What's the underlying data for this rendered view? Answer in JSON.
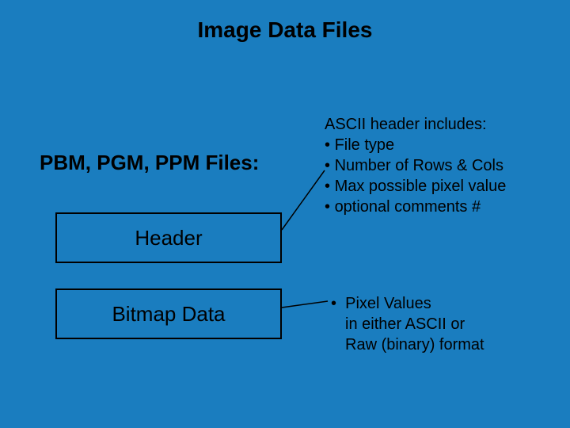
{
  "title": "Image Data Files",
  "subtitle": "PBM, PGM, PPM Files:",
  "boxes": {
    "header": "Header",
    "bitmap": "Bitmap Data"
  },
  "header_desc": {
    "lead": "ASCII header includes:",
    "items": [
      "File type",
      "Number of Rows & Cols",
      "Max possible pixel value",
      "optional comments  #"
    ]
  },
  "bitmap_desc": {
    "lead": "Pixel Values",
    "line2": "in either ASCII or",
    "line3": "Raw (binary) format"
  }
}
